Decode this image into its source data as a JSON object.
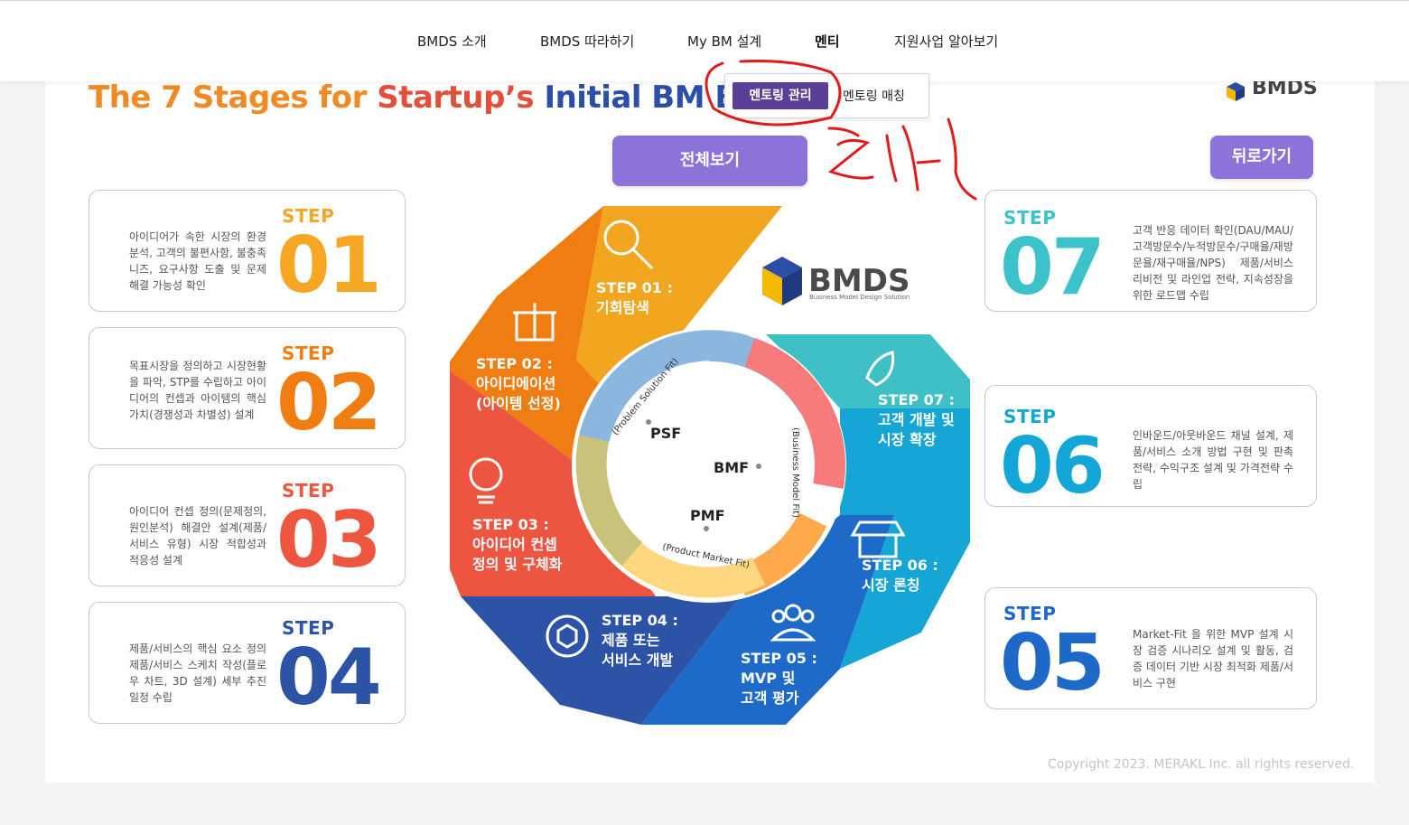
{
  "nav": {
    "items": [
      "BMDS 소개",
      "BMDS 따라하기",
      "My BM 설계",
      "멘티",
      "지원사업 알아보기"
    ]
  },
  "dropdown": {
    "active": "멘토링 관리",
    "other": "멘토링 매칭"
  },
  "title": {
    "part1": "The 7 Stages for ",
    "part2": "Startup’s ",
    "part3": "Initial BM Buil"
  },
  "buttons": {
    "view_all": "전체보기",
    "back": "뒤로가기"
  },
  "cards": [
    {
      "step": "STEP",
      "num": "01",
      "desc": "아이디어가 속한 시장의 환경분석, 고객의 불편사항, 불충족 니즈, 요구사항 도출 및 문제 해결 가능성 확인"
    },
    {
      "step": "STEP",
      "num": "02",
      "desc": "목표시장을 정의하고 시장현황을 파악, STP를 수립하고 아이디어의 컨셉과 아이템의 핵심가치(경쟁성과 차별성) 설계"
    },
    {
      "step": "STEP",
      "num": "03",
      "desc": "아이디어 컨셉 정의(문제정의,원인분석) 해결안 설계(제품/서비스 유형) 시장 적합성과 적응성 설계"
    },
    {
      "step": "STEP",
      "num": "04",
      "desc": "제품/서비스의 핵심 요소 정의 제품/서비스 스케치 작성(플로우 차트, 3D 설계) 세부 추진 일정 수립"
    },
    {
      "step": "STEP",
      "num": "07",
      "desc": "고객 반응 데이터 확인(DAU/MAU/고객방문수/누적방문수/구매율/재방문율/재구매율/NPS) 제품/서비스 리비전 및 라인업 전략, 지속성장을 위한 로드맵 수립"
    },
    {
      "step": "STEP",
      "num": "06",
      "desc": "인바운드/아웃바운드 채널 설계, 제품/서비스 소개 방법 구현 및 판촉 전략, 수익구조 설계 및 가격전략 수립"
    },
    {
      "step": "STEP",
      "num": "05",
      "desc": "Market-Fit 을 위한 MVP 설계 시장 검증 시나리오 설계 및 활동, 검증 데이터 기반 시장 최적화 제품/서비스 구현"
    }
  ],
  "diagram": {
    "logo": "BMDS",
    "logo_sub": "Business Model Design Solution",
    "stages": [
      {
        "line1": "STEP 01 :",
        "line2": "기회탐색"
      },
      {
        "line1": "STEP 02 :",
        "line2": "아이디에이션",
        "line3": "(아이템 선정)"
      },
      {
        "line1": "STEP 03 :",
        "line2": "아이디어 컨셉",
        "line3": "정의 및 구체화"
      },
      {
        "line1": "STEP 04 :",
        "line2": "제품 또는",
        "line3": "서비스 개발"
      },
      {
        "line1": "STEP 05 :",
        "line2": "MVP 및",
        "line3": "고객 평가"
      },
      {
        "line1": "STEP 06 :",
        "line2": "시장 론칭"
      },
      {
        "line1": "STEP 07 :",
        "line2": "고객 개발 및",
        "line3": "시장 확장"
      }
    ],
    "fits": {
      "psf": "PSF",
      "bmf": "BMF",
      "pmf": "PMF",
      "psf_full": "(Problem Solution Fit)",
      "bmf_full": "(Business Model Fit)",
      "pmf_full": "(Product Market Fit)"
    }
  },
  "corner_logo": "BMDS",
  "annotation_text": "클릭",
  "copyright": "Copyright 2023. MERAKL Inc. all rights reserved.",
  "colors": {
    "purple_button": "#8b73d9",
    "dropdown_active": "#5b3f96",
    "step01": "#f5a623",
    "step02": "#f07d12",
    "step03": "#ee5640",
    "step04": "#2d53a6",
    "step05": "#1e68c8",
    "step06": "#12a7d6",
    "step07": "#3cc3c9"
  }
}
